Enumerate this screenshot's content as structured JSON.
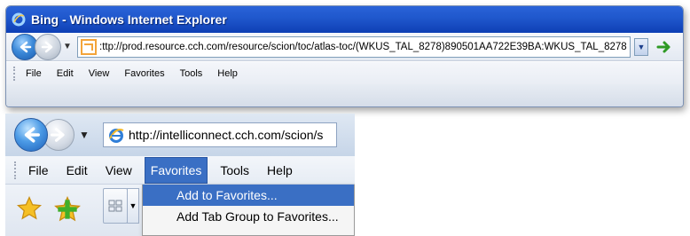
{
  "window1": {
    "title": "Bing - Windows Internet Explorer",
    "address": ":ttp://prod.resource.cch.com/resource/scion/toc/atlas-toc/(WKUS_TAL_8278)890501AA722E39BA:WKUS_TAL_8278",
    "menu": [
      "File",
      "Edit",
      "View",
      "Favorites",
      "Tools",
      "Help"
    ]
  },
  "window2": {
    "address": "http://intelliconnect.cch.com/scion/s",
    "menu": [
      "File",
      "Edit",
      "View",
      "Favorites",
      "Tools",
      "Help"
    ],
    "active_menu": "Favorites",
    "favorites_menu": [
      "Add to Favorites...",
      "Add Tab Group to Favorites..."
    ]
  },
  "colors": {
    "titlebar_blue": "#1f57cc",
    "menu_highlight": "#3a6fc4",
    "star_yellow": "#f5c026",
    "plus_green": "#3fae2a"
  },
  "icons": [
    "ie-icon",
    "back-arrow-icon",
    "forward-arrow-icon",
    "chevron-down-icon",
    "page-icon",
    "go-arrow-icon",
    "favorites-star-icon",
    "add-favorites-icon",
    "quick-tabs-icon"
  ]
}
